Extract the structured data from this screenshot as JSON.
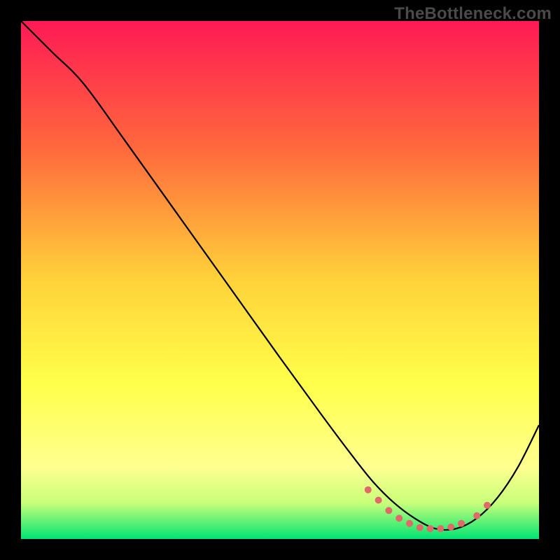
{
  "branding": {
    "watermark": "TheBottleneck.com"
  },
  "chart_data": {
    "type": "line",
    "title": "",
    "xlabel": "",
    "ylabel": "",
    "xlim": [
      0,
      100
    ],
    "ylim": [
      0,
      100
    ],
    "grid": false,
    "legend": false,
    "background_gradient_stops": [
      {
        "offset": 0.0,
        "color": "#ff1a55"
      },
      {
        "offset": 0.25,
        "color": "#ff6a3c"
      },
      {
        "offset": 0.5,
        "color": "#ffd23a"
      },
      {
        "offset": 0.7,
        "color": "#ffff4a"
      },
      {
        "offset": 0.86,
        "color": "#ffff90"
      },
      {
        "offset": 0.93,
        "color": "#c9ff7a"
      },
      {
        "offset": 1.0,
        "color": "#00e472"
      }
    ],
    "series": [
      {
        "name": "bottleneck-curve",
        "color": "#000000",
        "x": [
          0,
          6,
          12,
          20,
          30,
          40,
          50,
          58,
          64,
          68,
          72,
          76,
          80,
          84,
          88,
          92,
          96,
          100
        ],
        "y": [
          100,
          94,
          88,
          77,
          63,
          49,
          35,
          24,
          16,
          11,
          7,
          4,
          2,
          2,
          4,
          8,
          14,
          22
        ]
      }
    ],
    "markers": {
      "name": "sweet-spot",
      "color": "#e06a6a",
      "radius_px": 5,
      "points": [
        {
          "x": 67,
          "y": 9.5
        },
        {
          "x": 69,
          "y": 7.5
        },
        {
          "x": 71,
          "y": 5.5
        },
        {
          "x": 73,
          "y": 4.0
        },
        {
          "x": 75,
          "y": 3.0
        },
        {
          "x": 77,
          "y": 2.2
        },
        {
          "x": 79,
          "y": 2.0
        },
        {
          "x": 81,
          "y": 2.0
        },
        {
          "x": 83,
          "y": 2.3
        },
        {
          "x": 85,
          "y": 3.0
        },
        {
          "x": 88,
          "y": 4.5
        },
        {
          "x": 90,
          "y": 6.5
        }
      ]
    }
  }
}
